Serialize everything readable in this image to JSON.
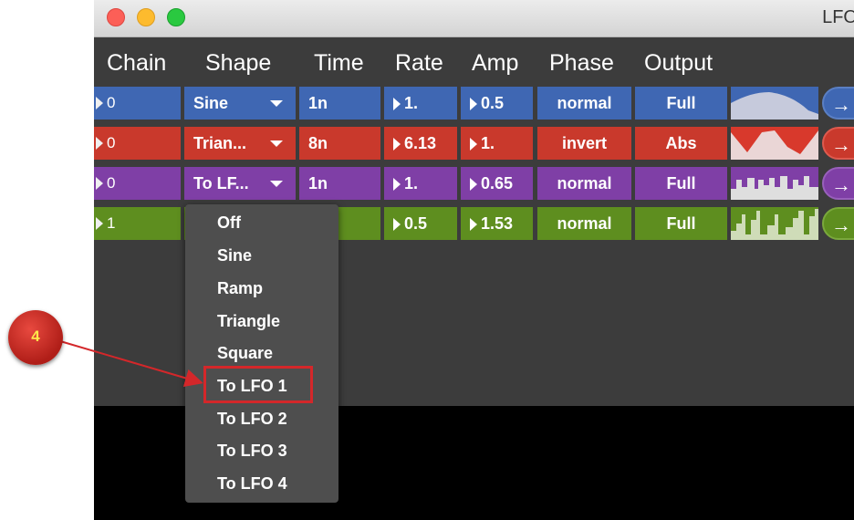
{
  "window": {
    "title": "LFO"
  },
  "headers": [
    "Chain",
    "Shape",
    "Time",
    "Rate",
    "Amp",
    "Phase",
    "Output"
  ],
  "colors": {
    "blue": "#3f67b3",
    "red": "#c9392c",
    "purple": "#7f3fa6",
    "green": "#5e8e1f",
    "callout": "#d4272a",
    "badge_text": "#ffe84a"
  },
  "rows": [
    {
      "color": "#3f67b3",
      "chain": "0",
      "shape": "Sine",
      "time": "1n",
      "rate": "1.",
      "amp": "0.5",
      "phase": "normal",
      "output": "Full",
      "go_icon": "arrow-right-icon"
    },
    {
      "color": "#c9392c",
      "chain": "0",
      "shape": "Trian...",
      "time": "8n",
      "rate": "6.13",
      "amp": "1.",
      "phase": "invert",
      "output": "Abs",
      "go_icon": "arrow-right-icon"
    },
    {
      "color": "#7f3fa6",
      "chain": "0",
      "shape": "To LF...",
      "time": "1n",
      "rate": "1.",
      "amp": "0.65",
      "phase": "normal",
      "output": "Full",
      "go_icon": "arrow-right-icon"
    },
    {
      "color": "#5e8e1f",
      "chain": "1",
      "shape": "",
      "time": "",
      "rate": "0.5",
      "amp": "1.53",
      "phase": "normal",
      "output": "Full",
      "go_icon": "arrow-right-icon"
    }
  ],
  "dropdown": {
    "items": [
      "Off",
      "Sine",
      "Ramp",
      "Triangle",
      "Square",
      "To LFO 1",
      "To LFO 2",
      "To LFO 3",
      "To LFO 4"
    ],
    "highlighted": "To LFO 1"
  },
  "callout": {
    "number": "4"
  }
}
